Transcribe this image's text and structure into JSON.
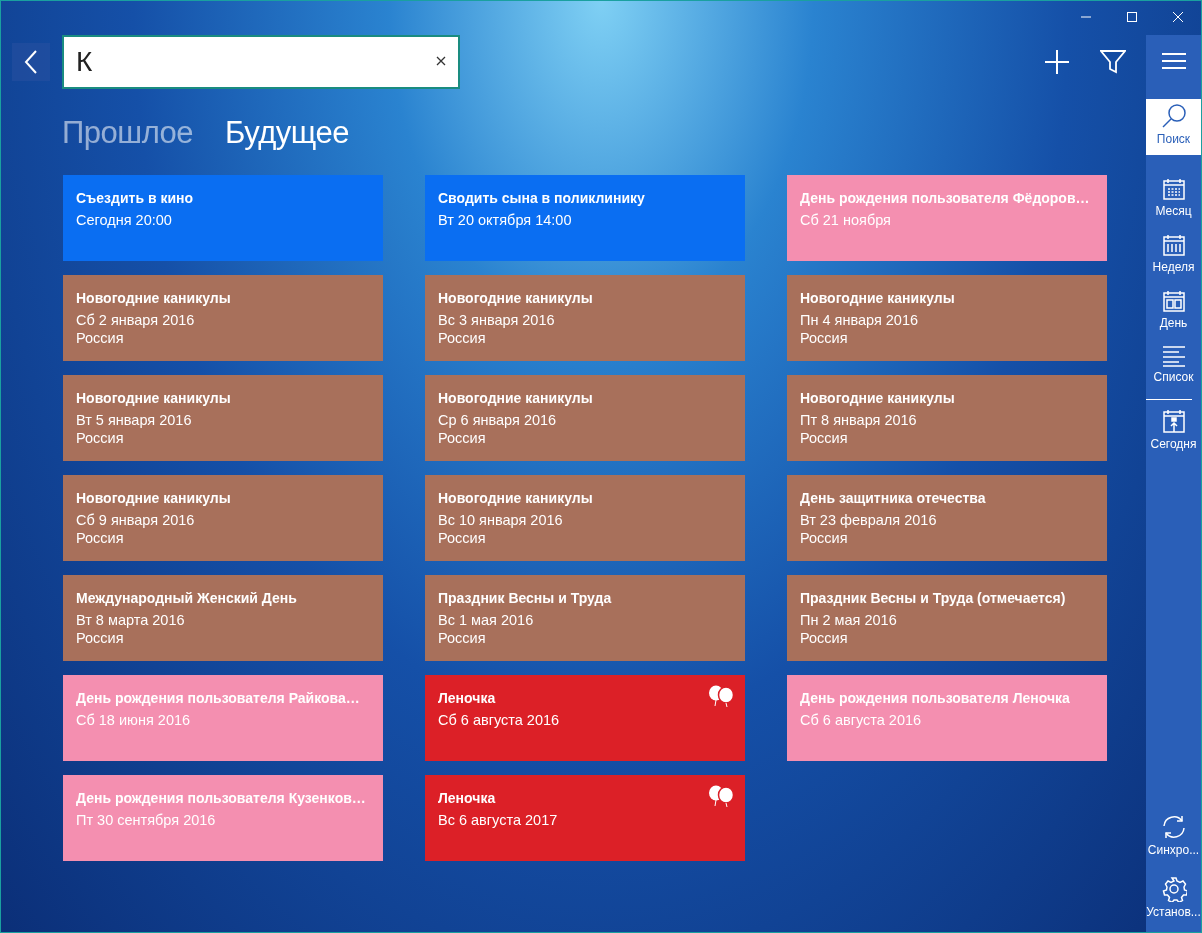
{
  "search": {
    "value": "К"
  },
  "tabs": [
    {
      "label": "Прошлое",
      "selected": false
    },
    {
      "label": "Будущее",
      "selected": true
    }
  ],
  "cards": [
    {
      "title": "Съездить в кино",
      "date": "Сегодня 20:00",
      "color": "#0a6ef2",
      "balloons": false
    },
    {
      "title": "Сводить сына в поликлинику",
      "date": "Вт 20 октября 14:00",
      "color": "#0a6ef2",
      "balloons": false
    },
    {
      "title": "День рождения пользователя Фёдоров…",
      "date": "Сб 21 ноября",
      "color": "#f48fb0",
      "balloons": false
    },
    {
      "title": "Новогодние каникулы",
      "date": "Сб 2 января 2016",
      "place": "Россия",
      "color": "#a8705b",
      "balloons": false
    },
    {
      "title": "Новогодние каникулы",
      "date": "Вс 3 января 2016",
      "place": "Россия",
      "color": "#a8705b",
      "balloons": false
    },
    {
      "title": "Новогодние каникулы",
      "date": "Пн 4 января 2016",
      "place": "Россия",
      "color": "#a8705b",
      "balloons": false
    },
    {
      "title": "Новогодние каникулы",
      "date": "Вт 5 января 2016",
      "place": "Россия",
      "color": "#a8705b",
      "balloons": false
    },
    {
      "title": "Новогодние каникулы",
      "date": "Ср 6 января 2016",
      "place": "Россия",
      "color": "#a8705b",
      "balloons": false
    },
    {
      "title": "Новогодние каникулы",
      "date": "Пт 8 января 2016",
      "place": "Россия",
      "color": "#a8705b",
      "balloons": false
    },
    {
      "title": "Новогодние каникулы",
      "date": "Сб 9 января 2016",
      "place": "Россия",
      "color": "#a8705b",
      "balloons": false
    },
    {
      "title": "Новогодние каникулы",
      "date": "Вс 10 января 2016",
      "place": "Россия",
      "color": "#a8705b",
      "balloons": false
    },
    {
      "title": "День защитника отечества",
      "date": "Вт 23 февраля 2016",
      "place": "Россия",
      "color": "#a8705b",
      "balloons": false
    },
    {
      "title": "Международный Женский День",
      "date": "Вт 8 марта 2016",
      "place": "Россия",
      "color": "#a8705b",
      "balloons": false
    },
    {
      "title": "Праздник Весны и Труда",
      "date": "Вс 1 мая 2016",
      "place": "Россия",
      "color": "#a8705b",
      "balloons": false
    },
    {
      "title": "Праздник Весны и Труда (отмечается)",
      "date": "Пн 2 мая 2016",
      "place": "Россия",
      "color": "#a8705b",
      "balloons": false
    },
    {
      "title": "День рождения пользователя Райкова…",
      "date": "Сб 18 июня 2016",
      "color": "#f48fb0",
      "balloons": false
    },
    {
      "title": "Леночка",
      "date": "Сб 6 августа 2016",
      "color": "#dc2027",
      "balloons": true
    },
    {
      "title": "День рождения пользователя Леночка",
      "date": "Сб 6 августа 2016",
      "color": "#f48fb0",
      "balloons": false
    },
    {
      "title": "День рождения пользователя Кузенков…",
      "date": "Пт 30 сентября 2016",
      "color": "#f48fb0",
      "balloons": false
    },
    {
      "title": "Леночка",
      "date": "Вс 6 августа 2017",
      "color": "#dc2027",
      "balloons": true
    }
  ],
  "sidebar": {
    "items": [
      {
        "kind": "search",
        "label": "Поиск",
        "selected": true
      },
      {
        "kind": "month",
        "label": "Месяц",
        "selected": false
      },
      {
        "kind": "week",
        "label": "Неделя",
        "selected": false
      },
      {
        "kind": "day",
        "label": "День",
        "selected": false
      },
      {
        "kind": "list",
        "label": "Список",
        "selected": false
      },
      {
        "kind": "today",
        "label": "Сегодня",
        "selected": false
      }
    ],
    "bottom": [
      {
        "kind": "sync",
        "label": "Синхро..."
      },
      {
        "kind": "settings",
        "label": "Установ..."
      }
    ]
  }
}
